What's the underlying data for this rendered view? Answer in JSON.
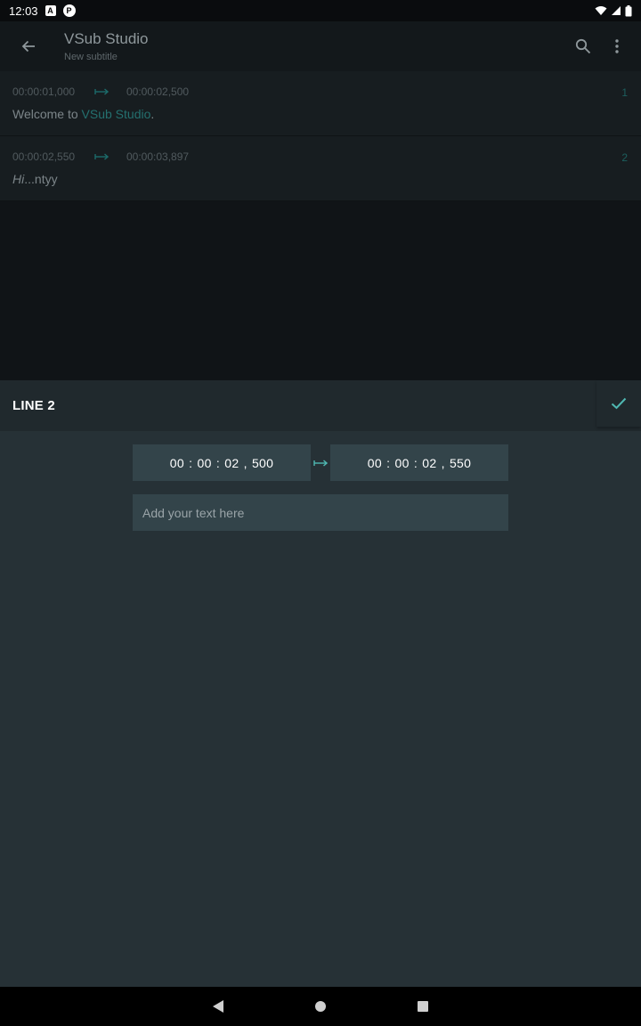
{
  "status_bar": {
    "time": "12:03",
    "badge_a": "A",
    "badge_b": "P"
  },
  "app_bar": {
    "title": "VSub Studio",
    "subtitle": "New subtitle"
  },
  "subtitles": [
    {
      "index": "1",
      "start": "00:00:01,000",
      "end": "00:00:02,500",
      "text_plain": "Welcome to ",
      "text_highlight": "VSub Studio",
      "text_suffix": "."
    },
    {
      "index": "2",
      "start": "00:00:02,550",
      "end": "00:00:03,897",
      "text_italic": "Hi",
      "text_rest": "...ntyy"
    }
  ],
  "editor": {
    "title": "LINE 2",
    "start_time": "00 : 00 : 02 , 500",
    "end_time": "00 : 00 : 02 , 550",
    "text_placeholder": "Add your text here",
    "text_value": ""
  },
  "colors": {
    "accent": "#24706f",
    "check": "#4fb8b2",
    "sheet_bg": "#263136",
    "field_bg": "#33444a"
  },
  "icons": {
    "back": "arrow-left-icon",
    "search": "search-icon",
    "more": "more-vert-icon",
    "confirm": "check-icon",
    "range": "range-arrow-icon"
  }
}
